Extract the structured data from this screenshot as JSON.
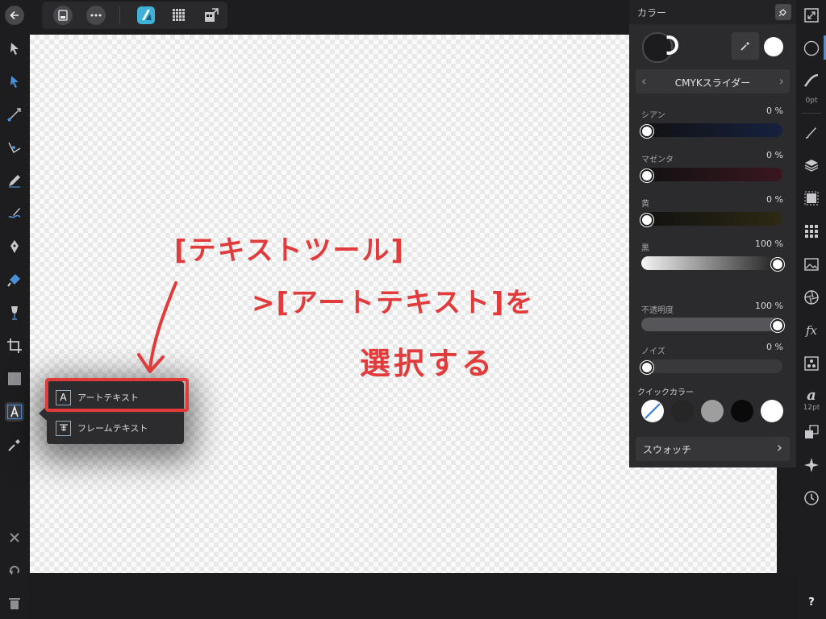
{
  "color_panel": {
    "title": "カラー",
    "mode_label": "CMYKスライダー",
    "sliders": [
      {
        "label": "シアン",
        "value": "0 %",
        "fraction": 0.0,
        "color": "#1b2446"
      },
      {
        "label": "マゼンタ",
        "value": "0 %",
        "fraction": 0.0,
        "color": "#3a1a22"
      },
      {
        "label": "黄",
        "value": "0 %",
        "fraction": 0.0,
        "color": "#2f2b14"
      },
      {
        "label": "黒",
        "value": "100 %",
        "fraction": 1.0
      }
    ],
    "opacity": {
      "label": "不透明度",
      "value": "100 %",
      "fraction": 1.0
    },
    "noise": {
      "label": "ノイズ",
      "value": "0 %",
      "fraction": 0.0
    },
    "quick_colors_label": "クイックカラー",
    "quick_colors": [
      "none",
      "#262626",
      "#9e9e9e",
      "#0a0a0a",
      "#ffffff"
    ],
    "swatches_label": "スウォッチ"
  },
  "right_studio": {
    "stroke_width": "0pt",
    "font_size": "12pt",
    "help": "?"
  },
  "tool_popup": {
    "items": [
      {
        "label": "アートテキスト",
        "icon": "art-text-icon"
      },
      {
        "label": "フレームテキスト",
        "icon": "frame-text-icon"
      }
    ]
  },
  "annotation": {
    "line1": "[テキストツール]",
    "line2": ">[アートテキスト]を",
    "line3": "選択する",
    "color": "#e23b3b"
  },
  "accent": "#4a90d9"
}
